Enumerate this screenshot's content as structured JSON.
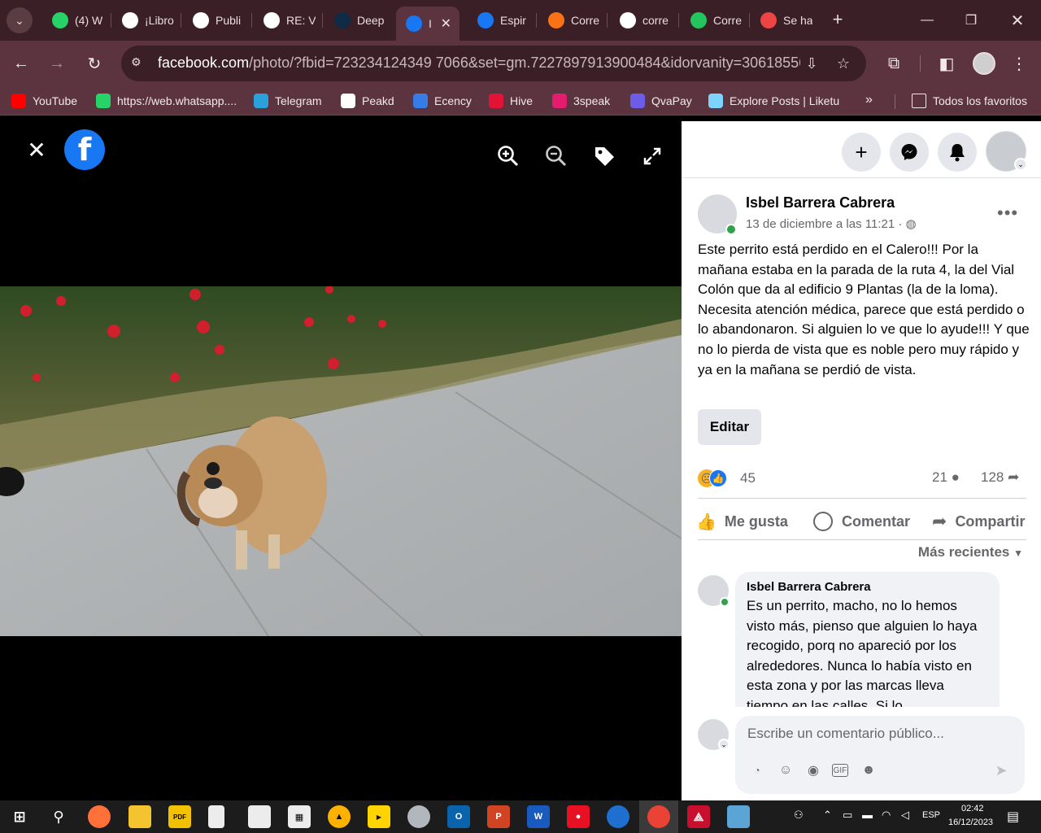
{
  "tabs": [
    {
      "label": "(4) W",
      "favicon": "whatsapp-icon",
      "color": "#25d366"
    },
    {
      "label": "¡Libro",
      "favicon": "hive-a-icon",
      "color": "#ffffff"
    },
    {
      "label": "Publi",
      "favicon": "hive-a-icon",
      "color": "#ffffff"
    },
    {
      "label": "RE: V",
      "favicon": "hive-a-icon",
      "color": "#ffffff"
    },
    {
      "label": "Deep",
      "favicon": "deepl-icon",
      "color": "#0f2b46"
    },
    {
      "label": "I",
      "favicon": "facebook-icon",
      "color": "#1877f2",
      "active": true
    },
    {
      "label": "Espir",
      "favicon": "facebook-icon",
      "color": "#1877f2"
    },
    {
      "label": "Corre",
      "favicon": "checkmark-icon",
      "color": "#f97316"
    },
    {
      "label": "corre",
      "favicon": "google-icon",
      "color": "#ffffff"
    },
    {
      "label": "Corre",
      "favicon": "checkmark-icon",
      "color": "#22c55e"
    },
    {
      "label": "Se ha",
      "favicon": "check-circle-icon",
      "color": "#ef4444"
    }
  ],
  "url": {
    "host": "facebook.com",
    "path": "/photo/?fbid=723234124349 7066&set=gm.7227897913900484&idorvanity=306185562..."
  },
  "bookmarks": [
    {
      "label": "YouTube",
      "icon": "youtube-icon",
      "color": "#ff0000"
    },
    {
      "label": "https://web.whatsapp....",
      "icon": "whatsapp-icon",
      "color": "#25d366"
    },
    {
      "label": "Telegram",
      "icon": "telegram-icon",
      "color": "#2aa1da"
    },
    {
      "label": "Peakd",
      "icon": "peakd-icon",
      "color": "#ffffff"
    },
    {
      "label": "Ecency",
      "icon": "ecency-icon",
      "color": "#357ce6"
    },
    {
      "label": "Hive",
      "icon": "hive-icon",
      "color": "#e31337"
    },
    {
      "label": "3speak",
      "icon": "3speak-icon",
      "color": "#e31c6e"
    },
    {
      "label": "QvaPay",
      "icon": "qvapay-icon",
      "color": "#6c5ce7"
    },
    {
      "label": "Explore Posts | Liketu",
      "icon": "liketu-icon",
      "color": "#7dd3fc"
    }
  ],
  "bookmarks_all": "Todos los favoritos",
  "post": {
    "author": "Isbel Barrera Cabrera",
    "date": "13 de diciembre a las 11:21 ·",
    "text": "Este perrito está perdido en el Calero!!! Por la mañana estaba en la parada de la ruta 4, la del Vial Colón que da al edificio 9 Plantas (la de la loma). Necesita atención médica, parece que está perdido o lo abandonaron. Si alguien lo ve que lo ayude!!! Y que no lo pierda de vista que es noble pero muy rápido y ya en la mañana se perdió de vista.",
    "edit_label": "Editar",
    "reactions_count": "45",
    "comments_count": "21",
    "shares_count": "128",
    "like_label": "Me gusta",
    "comment_label": "Comentar",
    "share_label": "Compartir",
    "sort_label": "Más recientes"
  },
  "comment": {
    "author": "Isbel Barrera Cabrera",
    "text": "Es un perrito, macho, no lo hemos visto más, pienso que alguien lo haya recogido, porq no apareció por los alrededores. Nunca lo había visto en esta zona y por las marcas lleva tiempo en las calles. Si lo"
  },
  "composer": {
    "placeholder": "Escribe un comentario público..."
  },
  "taskbar": {
    "lang": "ESP",
    "time": "02:42",
    "date": "16/12/2023"
  }
}
